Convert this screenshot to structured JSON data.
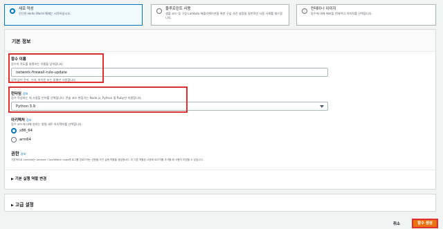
{
  "create_options": [
    {
      "title": "새로 작성",
      "desc": "간단한 Hello World 예제는 시작하십시오.",
      "selected": true
    },
    {
      "title": "블루프린트 사용",
      "desc": "샘플 코드 및 구성 Lambda 애플리케이션을 위한 구성 사전 설정을 일반적인 사용 사례를 빌드합니다.",
      "selected": false
    },
    {
      "title": "컨테이너 이미지",
      "desc": "함수에 대해 배포할 컨테이너 이미지를 선택합니다.",
      "selected": false
    }
  ],
  "basic_info": {
    "title": "기본 정보",
    "function_name": {
      "label": "함수 이름",
      "desc": "함수의 목도를 설명하는 이름을 입력합니다.",
      "value": "network-firewall-rule-update",
      "hint": "공백 없이 문자, 숫자, 하이픈 또는 밑줄만 사용합니다."
    },
    "runtime": {
      "label": "런타임",
      "info": "정보",
      "desc": "함수 작성하는 데 사용할 언어를 선택합니다. 콘솔 코드 편집기는 Node.js, Python 및 Ruby만 지원합니다.",
      "value": "Python 3.9"
    },
    "architecture": {
      "label": "아키텍처",
      "info": "정보",
      "desc": "함수 코드에 대해 원하는 명령 세트 아키텍처를 선택합니다.",
      "options": [
        {
          "label": "x86_64",
          "selected": true
        },
        {
          "label": "arm64",
          "selected": false
        }
      ]
    },
    "permissions": {
      "label": "권한",
      "info": "정보",
      "desc": "기본적으로 Lambda는 Amazon CloudWatch Logs에 로그를 업로드하는 권한을 가진 실행 역할을 생성합니다. 이 기본 역할은 나중에 트리거를 추가할 때 사용자 지정할 수 있습니다."
    },
    "default_role_label": "기본 실행 역할 변경"
  },
  "advanced": {
    "label": "고급 설정"
  },
  "footer": {
    "cancel": "취소",
    "create": "함수 생성"
  },
  "colors": {
    "accent": "#0073bb",
    "create_button": "#ec7211",
    "highlight": "#e02e2e"
  }
}
